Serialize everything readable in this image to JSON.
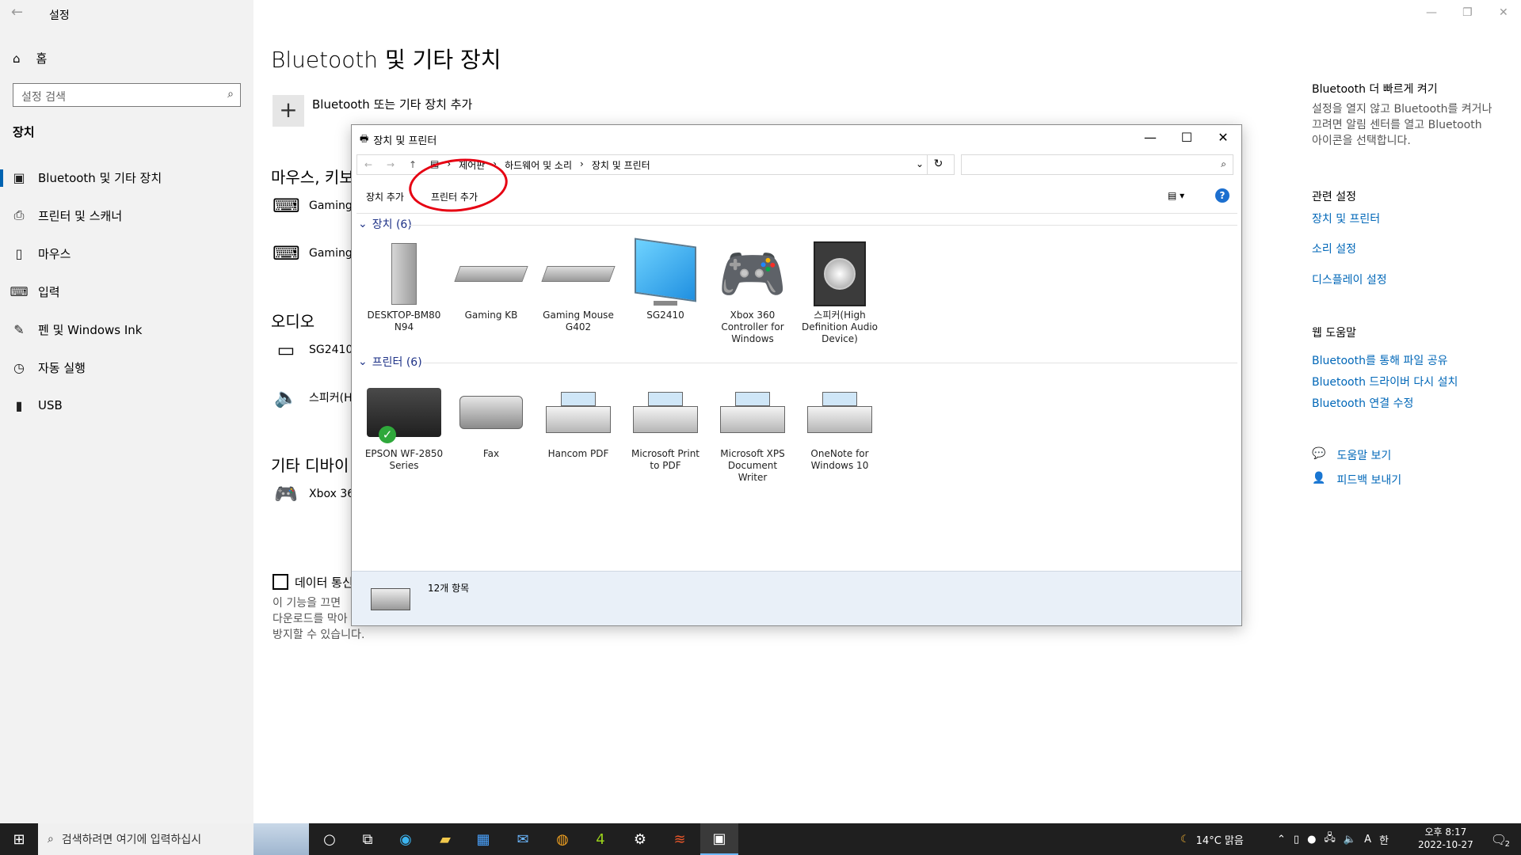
{
  "settings": {
    "app_title": "설정",
    "home": "홈",
    "search_placeholder": "설정 검색",
    "section": "장치",
    "nav": [
      {
        "label": "Bluetooth 및 기타 장치",
        "icon": "bluetooth-devices-icon"
      },
      {
        "label": "프린터 및 스캐너",
        "icon": "printer-icon"
      },
      {
        "label": "마우스",
        "icon": "mouse-icon"
      },
      {
        "label": "입력",
        "icon": "keyboard-icon"
      },
      {
        "label": "펜 및 Windows Ink",
        "icon": "pen-icon"
      },
      {
        "label": "자동 실행",
        "icon": "autoplay-icon"
      },
      {
        "label": "USB",
        "icon": "usb-icon"
      }
    ],
    "page_title": "Bluetooth 및 기타 장치",
    "add_device": "Bluetooth 또는 기타 장치 추가",
    "groups": {
      "mouse_keyboard": "마우스, 키보",
      "mouse_items": [
        "Gaming",
        "Gaming"
      ],
      "audio": "오디오",
      "audio_items": [
        "SG2410",
        "스피커(H"
      ],
      "other": "기타 디바이",
      "other_items": [
        "Xbox 36"
      ]
    },
    "data_checkbox_label": "데이터 통신",
    "data_desc": [
      "이 기능을 끄면",
      "다운로드를 막아",
      "방지할 수 있습니다."
    ],
    "right": {
      "quick_title": "Bluetooth 더 빠르게 켜기",
      "quick_desc": [
        "설정을 열지 않고 Bluetooth를 켜거나",
        "끄려면 알림 센터를 열고 Bluetooth",
        "아이콘을 선택합니다."
      ],
      "related_title": "관련 설정",
      "related_links": [
        "장치 및 프린터",
        "소리 설정",
        "디스플레이 설정"
      ],
      "help_title": "웹 도움말",
      "help_links": [
        "Bluetooth를 통해 파일 공유",
        "Bluetooth 드라이버 다시 설치",
        "Bluetooth 연결 수정"
      ],
      "get_help": "도움말 보기",
      "feedback": "피드백 보내기"
    }
  },
  "explorer": {
    "title": "장치 및 프린터",
    "breadcrumb": [
      "제어판",
      "하드웨어 및 소리",
      "장치 및 프린터"
    ],
    "toolbar": {
      "add_device": "장치 추가",
      "add_printer": "프린터 추가"
    },
    "devices_header": "장치 (6)",
    "devices": [
      "DESKTOP-BM80\nN94",
      "Gaming KB",
      "Gaming Mouse\nG402",
      "SG2410",
      "Xbox 360\nController for\nWindows",
      "스피커(High\nDefinition Audio\nDevice)"
    ],
    "printers_header": "프린터 (6)",
    "printers": [
      "EPSON WF-2850\nSeries",
      "Fax",
      "Hancom PDF",
      "Microsoft Print\nto PDF",
      "Microsoft XPS\nDocument\nWriter",
      "OneNote for\nWindows 10"
    ],
    "status": "12개 항목"
  },
  "taskbar": {
    "search_placeholder": "검색하려면 여기에 입력하십시",
    "weather": "14°C 맑음",
    "time": "오후 8:17",
    "date": "2022-10-27",
    "notification_count": "2",
    "ime": "A"
  }
}
